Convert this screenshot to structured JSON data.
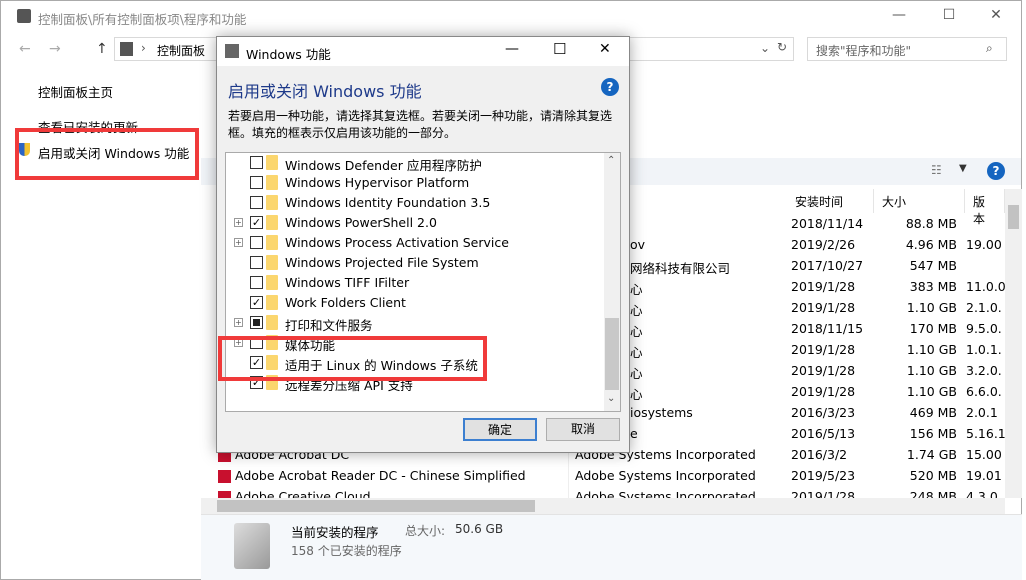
{
  "main": {
    "title": "控制面板\\所有控制面板项\\程序和功能",
    "breadcrumb": "控制面板",
    "search_placeholder": "搜索\"程序和功能\"",
    "left_links": [
      "控制面板主页",
      "查看已安装的更新",
      "启用或关闭 Windows 功能"
    ],
    "columns": [
      "安装时间",
      "大小",
      "版本"
    ],
    "rows": [
      {
        "name": "",
        "publisher": "",
        "date": "2018/11/14",
        "size": "88.8 MB",
        "version": ""
      },
      {
        "name": "",
        "publisher": "ov",
        "date": "2019/2/26",
        "size": "4.96 MB",
        "version": "19.00"
      },
      {
        "name": "",
        "publisher": "网络科技有限公司",
        "date": "2017/10/27",
        "size": "547 MB",
        "version": ""
      },
      {
        "name": "",
        "publisher": "心",
        "date": "2019/1/28",
        "size": "383 MB",
        "version": "11.0.0"
      },
      {
        "name": "",
        "publisher": "心",
        "date": "2019/1/28",
        "size": "1.10 GB",
        "version": "2.1.0."
      },
      {
        "name": "",
        "publisher": "心",
        "date": "2018/11/15",
        "size": "170 MB",
        "version": "9.5.0."
      },
      {
        "name": "",
        "publisher": "心",
        "date": "2019/1/28",
        "size": "1.10 GB",
        "version": "1.0.1."
      },
      {
        "name": "",
        "publisher": "心",
        "date": "2019/1/28",
        "size": "1.10 GB",
        "version": "3.2.0."
      },
      {
        "name": "",
        "publisher": "心",
        "date": "2019/1/28",
        "size": "1.10 GB",
        "version": "6.6.0."
      },
      {
        "name": "",
        "publisher": "iosystems",
        "date": "2016/3/23",
        "size": "469 MB",
        "version": "2.0.1"
      },
      {
        "name": "",
        "publisher": "e",
        "date": "2016/5/13",
        "size": "156 MB",
        "version": "5.16.1"
      },
      {
        "name": "Adobe Acrobat DC",
        "publisher": "Adobe Systems Incorporated",
        "date": "2016/3/2",
        "size": "1.74 GB",
        "version": "15.00"
      },
      {
        "name": "Adobe Acrobat Reader DC - Chinese Simplified",
        "publisher": "Adobe Systems Incorporated",
        "date": "2019/5/23",
        "size": "520 MB",
        "version": "19.01"
      },
      {
        "name": "Adobe Creative Cloud",
        "publisher": "Adobe Systems Incorporated",
        "date": "2019/1/28",
        "size": "248 MB",
        "version": "4.3.0"
      }
    ],
    "status": {
      "title": "当前安装的程序",
      "total_label": "总大小:",
      "total": "50.6 GB",
      "count": "158 个已安装的程序"
    }
  },
  "dialog": {
    "title": "Windows 功能",
    "heading": "启用或关闭 Windows 功能",
    "description": "若要启用一种功能，请选择其复选框。若要关闭一种功能，请清除其复选框。填充的框表示仅启用该功能的一部分。",
    "features": [
      {
        "label": "Windows Defender 应用程序防护",
        "state": "unchecked",
        "expandable": false
      },
      {
        "label": "Windows Hypervisor Platform",
        "state": "unchecked",
        "expandable": false
      },
      {
        "label": "Windows Identity Foundation 3.5",
        "state": "unchecked",
        "expandable": false
      },
      {
        "label": "Windows PowerShell 2.0",
        "state": "checked",
        "expandable": true
      },
      {
        "label": "Windows Process Activation Service",
        "state": "unchecked",
        "expandable": true
      },
      {
        "label": "Windows Projected File System",
        "state": "unchecked",
        "expandable": false
      },
      {
        "label": "Windows TIFF IFilter",
        "state": "unchecked",
        "expandable": false
      },
      {
        "label": "Work Folders Client",
        "state": "checked",
        "expandable": false
      },
      {
        "label": "打印和文件服务",
        "state": "partial",
        "expandable": true
      },
      {
        "label": "媒体功能",
        "state": "unchecked",
        "expandable": true
      },
      {
        "label": "适用于 Linux 的 Windows 子系统",
        "state": "checked",
        "expandable": false
      },
      {
        "label": "远程差分压缩 API 支持",
        "state": "checked",
        "expandable": false
      }
    ],
    "ok": "确定",
    "cancel": "取消"
  },
  "colors": {
    "highlight": "#f03a3a",
    "heading": "#1e3a8a",
    "help": "#1565c0",
    "folder": "#fbd66e"
  }
}
